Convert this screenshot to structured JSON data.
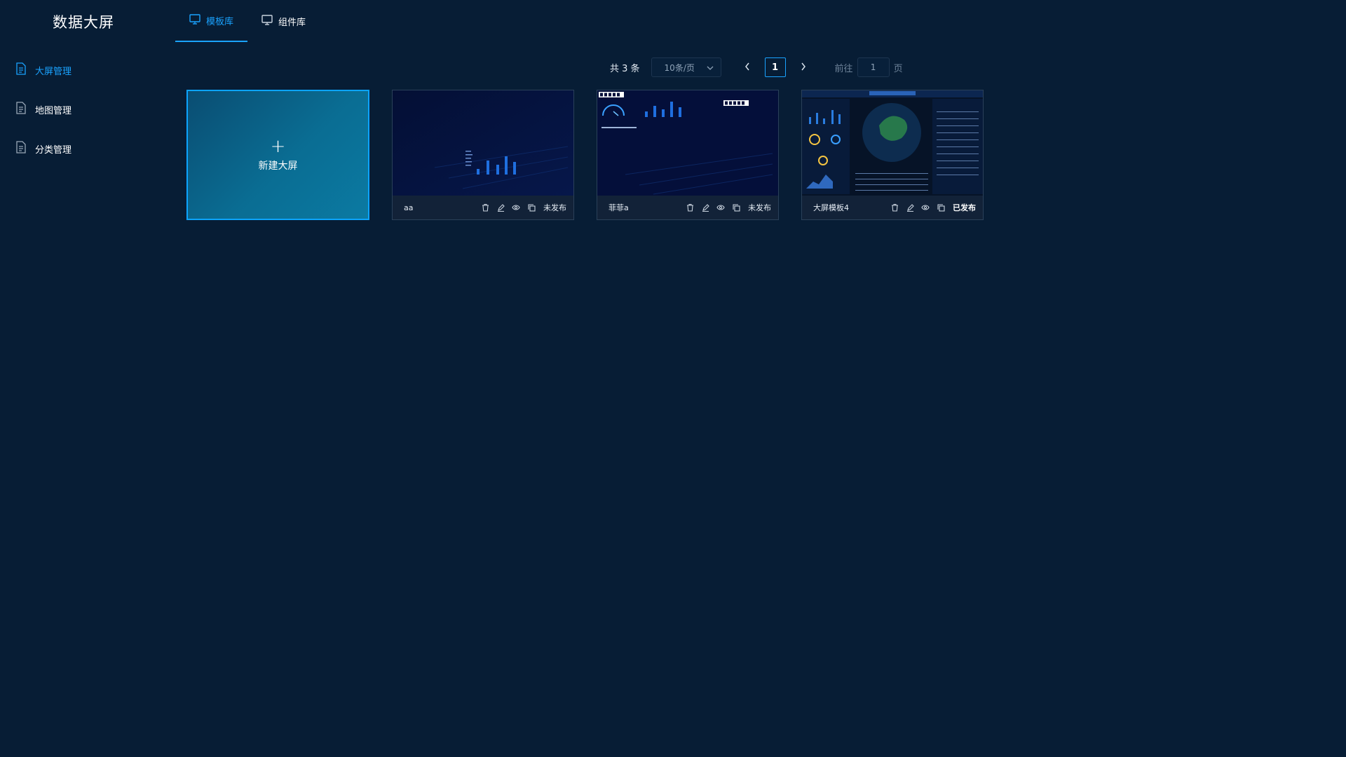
{
  "app": {
    "title": "数据大屏"
  },
  "topnav": {
    "tabs": [
      {
        "label": "模板库",
        "icon": "monitor-icon",
        "active": true
      },
      {
        "label": "组件库",
        "icon": "monitor-icon",
        "active": false
      }
    ]
  },
  "sidebar": {
    "items": [
      {
        "label": "大屏管理",
        "icon": "document-icon",
        "active": true
      },
      {
        "label": "地图管理",
        "icon": "document-icon",
        "active": false
      },
      {
        "label": "分类管理",
        "icon": "document-icon",
        "active": false
      }
    ]
  },
  "pagination": {
    "total_text": "共 3 条",
    "page_size": "10条/页",
    "current_page": "1",
    "goto_label": "前往",
    "goto_value": "1",
    "page_suffix": "页"
  },
  "new_card": {
    "plus": "+",
    "label": "新建大屏"
  },
  "cards": [
    {
      "name": "aa",
      "status": "未发布",
      "thumbnail": "bar-chart-preview"
    },
    {
      "name": "菲菲a",
      "status": "未发布",
      "thumbnail": "gauge-and-bar-preview"
    },
    {
      "name": "大屏模板4",
      "status": "已发布",
      "thumbnail": "map-dashboard-preview"
    }
  ],
  "colors": {
    "background": "#071d35",
    "accent": "#1aa3ff",
    "card_footer": "#122238"
  }
}
